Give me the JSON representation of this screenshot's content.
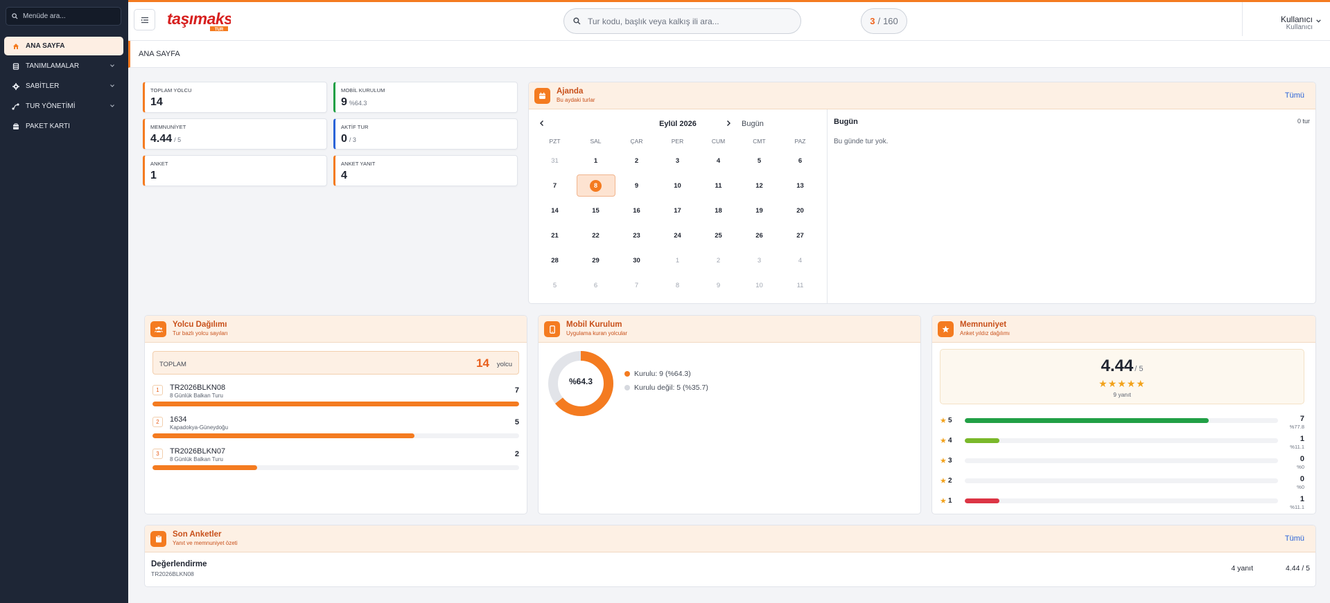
{
  "sidebar": {
    "search_placeholder": "Menüde ara...",
    "items": [
      {
        "label": "ANA SAYFA",
        "icon": "home-icon",
        "active": true
      },
      {
        "label": "TANIMLAMALAR",
        "icon": "database-icon",
        "expandable": true
      },
      {
        "label": "SABİTLER",
        "icon": "gear-icon",
        "expandable": true
      },
      {
        "label": "TUR YÖNETİMİ",
        "icon": "route-icon",
        "expandable": true
      },
      {
        "label": "PAKET KARTI",
        "icon": "card-icon"
      }
    ]
  },
  "topbar": {
    "logo_text": "taşımaks",
    "logo_badge": "TUR",
    "search_placeholder": "Tur kodu, başlık veya kalkış ili ara...",
    "counter_current": "3",
    "counter_sep": "/",
    "counter_total": "160",
    "user_name": "Kullanıcı",
    "user_role": "Kullanıcı"
  },
  "breadcrumb": "ANA SAYFA",
  "stats": [
    {
      "label": "TOPLAM YOLCU",
      "value": "14",
      "suffix": ""
    },
    {
      "label": "MOBİL KURULUM",
      "value": "9",
      "suffix": "%64.3"
    },
    {
      "label": "MEMNUNİYET",
      "value": "4.44",
      "suffix": "/ 5"
    },
    {
      "label": "AKTİF TUR",
      "value": "0",
      "suffix": "/ 3"
    },
    {
      "label": "ANKET",
      "value": "1",
      "suffix": ""
    },
    {
      "label": "ANKET YANIT",
      "value": "4",
      "suffix": ""
    }
  ],
  "agenda": {
    "title": "Ajanda",
    "subtitle": "Bu aydaki turlar",
    "link": "Tümü",
    "month": "Eylül 2026",
    "today_btn": "Bugün",
    "dow": [
      "PZT",
      "SAL",
      "ÇAR",
      "PER",
      "CUM",
      "CMT",
      "PAZ"
    ],
    "days": [
      {
        "d": "31",
        "muted": true
      },
      {
        "d": "1"
      },
      {
        "d": "2"
      },
      {
        "d": "3"
      },
      {
        "d": "4"
      },
      {
        "d": "5"
      },
      {
        "d": "6"
      },
      {
        "d": "7"
      },
      {
        "d": "8",
        "today": true
      },
      {
        "d": "9"
      },
      {
        "d": "10"
      },
      {
        "d": "11"
      },
      {
        "d": "12"
      },
      {
        "d": "13"
      },
      {
        "d": "14"
      },
      {
        "d": "15"
      },
      {
        "d": "16"
      },
      {
        "d": "17"
      },
      {
        "d": "18"
      },
      {
        "d": "19"
      },
      {
        "d": "20"
      },
      {
        "d": "21"
      },
      {
        "d": "22"
      },
      {
        "d": "23"
      },
      {
        "d": "24"
      },
      {
        "d": "25"
      },
      {
        "d": "26"
      },
      {
        "d": "27"
      },
      {
        "d": "28"
      },
      {
        "d": "29"
      },
      {
        "d": "30"
      },
      {
        "d": "1",
        "muted": true
      },
      {
        "d": "2",
        "muted": true
      },
      {
        "d": "3",
        "muted": true
      },
      {
        "d": "4",
        "muted": true
      },
      {
        "d": "5",
        "muted": true
      },
      {
        "d": "6",
        "muted": true
      },
      {
        "d": "7",
        "muted": true
      },
      {
        "d": "8",
        "muted": true
      },
      {
        "d": "9",
        "muted": true
      },
      {
        "d": "10",
        "muted": true
      },
      {
        "d": "11",
        "muted": true
      }
    ],
    "day_title": "Bugün",
    "day_count": "0 tur",
    "day_empty": "Bu günde tur yok."
  },
  "passengers": {
    "title": "Yolcu Dağılımı",
    "subtitle": "Tur bazlı yolcu sayıları",
    "total_label": "TOPLAM",
    "total_value": "14",
    "total_unit": "yolcu",
    "rows": [
      {
        "rank": "1",
        "code": "TR2026BLKN08",
        "name": "8 Günlük Balkan Turu",
        "value": "7",
        "fraction": 1.0
      },
      {
        "rank": "2",
        "code": "1634",
        "name": "Kapadokya-Güneydoğu",
        "value": "5",
        "fraction": 0.714
      },
      {
        "rank": "3",
        "code": "TR2026BLKN07",
        "name": "8 Günlük Balkan Turu",
        "value": "2",
        "fraction": 0.286
      }
    ]
  },
  "mobile": {
    "title": "Mobil Kurulum",
    "subtitle": "Uygulama kuran yolcular",
    "center_label": "%64.3",
    "installed_percent": 64.3,
    "legend": [
      {
        "label": "Kurulu: 9  (%64.3)",
        "color": "#f47b20"
      },
      {
        "label": "Kurulu değil: 5  (%35.7)",
        "color": "#d6d9df"
      }
    ]
  },
  "satisfaction": {
    "title": "Memnuniyet",
    "subtitle": "Anket yıldız dağılımı",
    "score": "4.44",
    "score_max": "/ 5",
    "stars": "★★★★★",
    "responses": "9 yanıt",
    "distribution": [
      {
        "star": "5",
        "count": "7",
        "pct": "%77.8",
        "fraction": 0.778,
        "color": "#22a046"
      },
      {
        "star": "4",
        "count": "1",
        "pct": "%11.1",
        "fraction": 0.111,
        "color": "#7ab82a"
      },
      {
        "star": "3",
        "count": "0",
        "pct": "%0",
        "fraction": 0,
        "color": "#f2a21b"
      },
      {
        "star": "2",
        "count": "0",
        "pct": "%0",
        "fraction": 0,
        "color": "#f47b20"
      },
      {
        "star": "1",
        "count": "1",
        "pct": "%11.1",
        "fraction": 0.111,
        "color": "#dc3545"
      }
    ]
  },
  "surveys": {
    "title": "Son Anketler",
    "subtitle": "Yanıt ve memnuniyet özeti",
    "link": "Tümü",
    "items": [
      {
        "title": "Değerlendirme",
        "code": "TR2026BLKN08",
        "responses": "4 yanıt",
        "score": "4.44 / 5"
      }
    ]
  },
  "colors": {
    "accent": "#f47b20",
    "sidebar": "#1e2636",
    "panel_head": "#fdf0e4"
  }
}
